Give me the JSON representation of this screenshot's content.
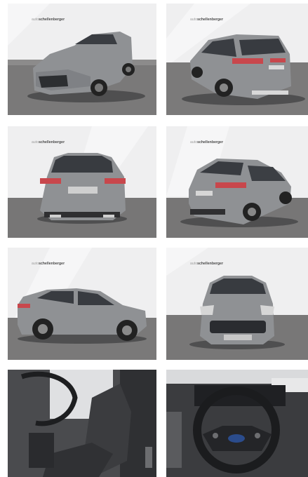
{
  "gallery": {
    "watermark_prefix": "auto",
    "watermark_brand": "schellenberger",
    "photos": [
      {
        "view": "front-left-exterior"
      },
      {
        "view": "rear-right-exterior"
      },
      {
        "view": "rear-exterior"
      },
      {
        "view": "rear-left-exterior"
      },
      {
        "view": "side-left-exterior"
      },
      {
        "view": "front-exterior"
      },
      {
        "view": "interior-driver-seat"
      },
      {
        "view": "interior-steering-wheel"
      }
    ]
  },
  "colors": {
    "body_paint": "#8f9194",
    "backdrop": "#eeeeef",
    "floor": "#6f6e6e",
    "tail_light": "#c8474c"
  }
}
